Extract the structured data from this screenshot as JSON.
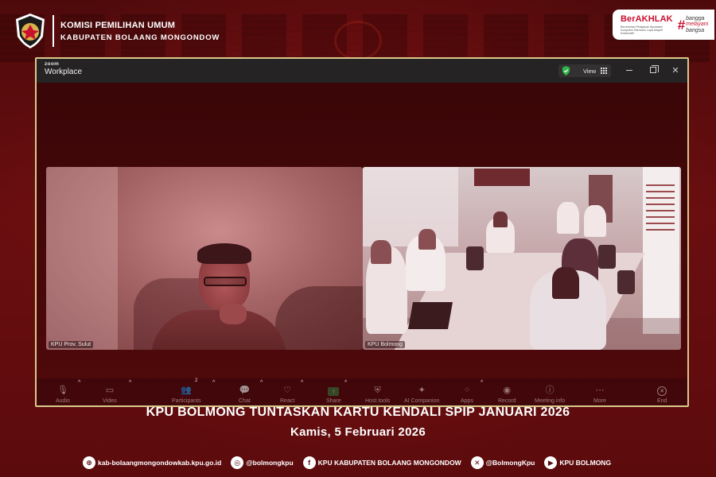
{
  "header": {
    "org_title": "KOMISI PEMILIHAN UMUM",
    "org_subtitle": "KABUPATEN BOLAANG MONGONDOW",
    "logo_text_top": "KOMISI",
    "logo_text_bottom": "PEMILIHAN UMUM"
  },
  "berakhlak": {
    "word": "BerAKHLAK",
    "tagline": "Berorientasi Pelayanan Akuntabel Kompeten Harmonis Loyal Adaptif Kolaboratif",
    "hash": "#",
    "bangga_line1": "bangga",
    "bangga_line2": "melayani",
    "bangga_line3": "bangsa"
  },
  "zoom": {
    "brand_top": "zoom",
    "brand_main": "Workplace",
    "view_label": "View",
    "window_controls": [
      "minimize-icon",
      "restore-icon",
      "close-icon"
    ],
    "tiles": [
      {
        "label": "KPU Prov. Sulut"
      },
      {
        "label": "KPU Bolmong"
      }
    ],
    "toolbar": [
      {
        "label": "Audio",
        "icon": "microphone-icon"
      },
      {
        "label": "Video",
        "icon": "video-camera-icon"
      },
      {
        "label": "Participants",
        "icon": "participants-icon",
        "badge": "2"
      },
      {
        "label": "Chat",
        "icon": "chat-icon"
      },
      {
        "label": "React",
        "icon": "heart-icon"
      },
      {
        "label": "Share",
        "icon": "share-screen-icon"
      },
      {
        "label": "Host tools",
        "icon": "shield-icon"
      },
      {
        "label": "AI Companion",
        "icon": "sparkle-icon"
      },
      {
        "label": "Apps",
        "icon": "apps-icon"
      },
      {
        "label": "Record",
        "icon": "record-icon"
      },
      {
        "label": "Meeting info",
        "icon": "info-icon"
      },
      {
        "label": "More",
        "icon": "more-icon"
      },
      {
        "label": "End",
        "icon": "end-icon"
      }
    ]
  },
  "headline": "KPU BOLMONG TUNTASKAN KARTU KENDALI SPIP JANUARI 2026",
  "subheadline": "Kamis, 5 Februari 2026",
  "footer": [
    {
      "icon": "globe-icon",
      "text": "kab-bolaangmongondowkab.kpu.go.id"
    },
    {
      "icon": "instagram-icon",
      "text": "@bolmongkpu"
    },
    {
      "icon": "facebook-icon",
      "text": "KPU KABUPATEN BOLAANG MONGONDOW"
    },
    {
      "icon": "x-icon",
      "text": "@BolmongKpu"
    },
    {
      "icon": "youtube-icon",
      "text": "KPU BOLMONG"
    }
  ],
  "colors": {
    "background": "#5a0b0c",
    "accent_red": "#c9102f",
    "zoom_frame": "#d8c98a",
    "share_green": "#2c7c3c"
  }
}
